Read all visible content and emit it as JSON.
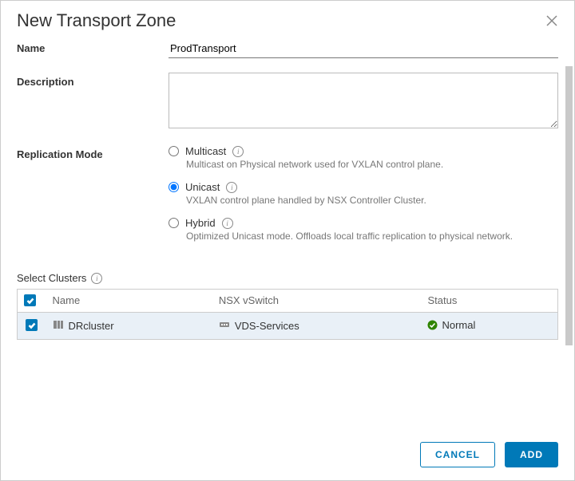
{
  "dialog": {
    "title": "New Transport Zone"
  },
  "form": {
    "name_label": "Name",
    "name_value": "ProdTransport",
    "description_label": "Description",
    "description_value": "",
    "replication_label": "Replication Mode",
    "replication_options": [
      {
        "name": "Multicast",
        "desc": "Multicast on Physical network used for VXLAN control plane.",
        "selected": false
      },
      {
        "name": "Unicast",
        "desc": "VXLAN control plane handled by NSX Controller Cluster.",
        "selected": true
      },
      {
        "name": "Hybrid",
        "desc": "Optimized Unicast mode. Offloads local traffic replication to physical network.",
        "selected": false
      }
    ]
  },
  "clusters": {
    "label": "Select Clusters",
    "columns": {
      "name": "Name",
      "vswitch": "NSX vSwitch",
      "status": "Status"
    },
    "rows": [
      {
        "name": "DRcluster",
        "vswitch": "VDS-Services",
        "status": "Normal",
        "checked": true
      }
    ]
  },
  "footer": {
    "cancel": "CANCEL",
    "add": "ADD"
  }
}
